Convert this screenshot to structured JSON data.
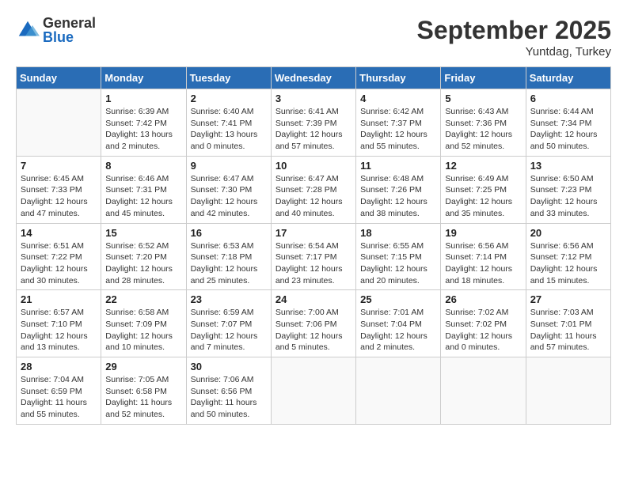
{
  "header": {
    "logo": {
      "general": "General",
      "blue": "Blue"
    },
    "title": "September 2025",
    "location": "Yuntdag, Turkey"
  },
  "columns": [
    "Sunday",
    "Monday",
    "Tuesday",
    "Wednesday",
    "Thursday",
    "Friday",
    "Saturday"
  ],
  "weeks": [
    [
      {
        "day": "",
        "info": ""
      },
      {
        "day": "1",
        "info": "Sunrise: 6:39 AM\nSunset: 7:42 PM\nDaylight: 13 hours\nand 2 minutes."
      },
      {
        "day": "2",
        "info": "Sunrise: 6:40 AM\nSunset: 7:41 PM\nDaylight: 13 hours\nand 0 minutes."
      },
      {
        "day": "3",
        "info": "Sunrise: 6:41 AM\nSunset: 7:39 PM\nDaylight: 12 hours\nand 57 minutes."
      },
      {
        "day": "4",
        "info": "Sunrise: 6:42 AM\nSunset: 7:37 PM\nDaylight: 12 hours\nand 55 minutes."
      },
      {
        "day": "5",
        "info": "Sunrise: 6:43 AM\nSunset: 7:36 PM\nDaylight: 12 hours\nand 52 minutes."
      },
      {
        "day": "6",
        "info": "Sunrise: 6:44 AM\nSunset: 7:34 PM\nDaylight: 12 hours\nand 50 minutes."
      }
    ],
    [
      {
        "day": "7",
        "info": "Sunrise: 6:45 AM\nSunset: 7:33 PM\nDaylight: 12 hours\nand 47 minutes."
      },
      {
        "day": "8",
        "info": "Sunrise: 6:46 AM\nSunset: 7:31 PM\nDaylight: 12 hours\nand 45 minutes."
      },
      {
        "day": "9",
        "info": "Sunrise: 6:47 AM\nSunset: 7:30 PM\nDaylight: 12 hours\nand 42 minutes."
      },
      {
        "day": "10",
        "info": "Sunrise: 6:47 AM\nSunset: 7:28 PM\nDaylight: 12 hours\nand 40 minutes."
      },
      {
        "day": "11",
        "info": "Sunrise: 6:48 AM\nSunset: 7:26 PM\nDaylight: 12 hours\nand 38 minutes."
      },
      {
        "day": "12",
        "info": "Sunrise: 6:49 AM\nSunset: 7:25 PM\nDaylight: 12 hours\nand 35 minutes."
      },
      {
        "day": "13",
        "info": "Sunrise: 6:50 AM\nSunset: 7:23 PM\nDaylight: 12 hours\nand 33 minutes."
      }
    ],
    [
      {
        "day": "14",
        "info": "Sunrise: 6:51 AM\nSunset: 7:22 PM\nDaylight: 12 hours\nand 30 minutes."
      },
      {
        "day": "15",
        "info": "Sunrise: 6:52 AM\nSunset: 7:20 PM\nDaylight: 12 hours\nand 28 minutes."
      },
      {
        "day": "16",
        "info": "Sunrise: 6:53 AM\nSunset: 7:18 PM\nDaylight: 12 hours\nand 25 minutes."
      },
      {
        "day": "17",
        "info": "Sunrise: 6:54 AM\nSunset: 7:17 PM\nDaylight: 12 hours\nand 23 minutes."
      },
      {
        "day": "18",
        "info": "Sunrise: 6:55 AM\nSunset: 7:15 PM\nDaylight: 12 hours\nand 20 minutes."
      },
      {
        "day": "19",
        "info": "Sunrise: 6:56 AM\nSunset: 7:14 PM\nDaylight: 12 hours\nand 18 minutes."
      },
      {
        "day": "20",
        "info": "Sunrise: 6:56 AM\nSunset: 7:12 PM\nDaylight: 12 hours\nand 15 minutes."
      }
    ],
    [
      {
        "day": "21",
        "info": "Sunrise: 6:57 AM\nSunset: 7:10 PM\nDaylight: 12 hours\nand 13 minutes."
      },
      {
        "day": "22",
        "info": "Sunrise: 6:58 AM\nSunset: 7:09 PM\nDaylight: 12 hours\nand 10 minutes."
      },
      {
        "day": "23",
        "info": "Sunrise: 6:59 AM\nSunset: 7:07 PM\nDaylight: 12 hours\nand 7 minutes."
      },
      {
        "day": "24",
        "info": "Sunrise: 7:00 AM\nSunset: 7:06 PM\nDaylight: 12 hours\nand 5 minutes."
      },
      {
        "day": "25",
        "info": "Sunrise: 7:01 AM\nSunset: 7:04 PM\nDaylight: 12 hours\nand 2 minutes."
      },
      {
        "day": "26",
        "info": "Sunrise: 7:02 AM\nSunset: 7:02 PM\nDaylight: 12 hours\nand 0 minutes."
      },
      {
        "day": "27",
        "info": "Sunrise: 7:03 AM\nSunset: 7:01 PM\nDaylight: 11 hours\nand 57 minutes."
      }
    ],
    [
      {
        "day": "28",
        "info": "Sunrise: 7:04 AM\nSunset: 6:59 PM\nDaylight: 11 hours\nand 55 minutes."
      },
      {
        "day": "29",
        "info": "Sunrise: 7:05 AM\nSunset: 6:58 PM\nDaylight: 11 hours\nand 52 minutes."
      },
      {
        "day": "30",
        "info": "Sunrise: 7:06 AM\nSunset: 6:56 PM\nDaylight: 11 hours\nand 50 minutes."
      },
      {
        "day": "",
        "info": ""
      },
      {
        "day": "",
        "info": ""
      },
      {
        "day": "",
        "info": ""
      },
      {
        "day": "",
        "info": ""
      }
    ]
  ]
}
